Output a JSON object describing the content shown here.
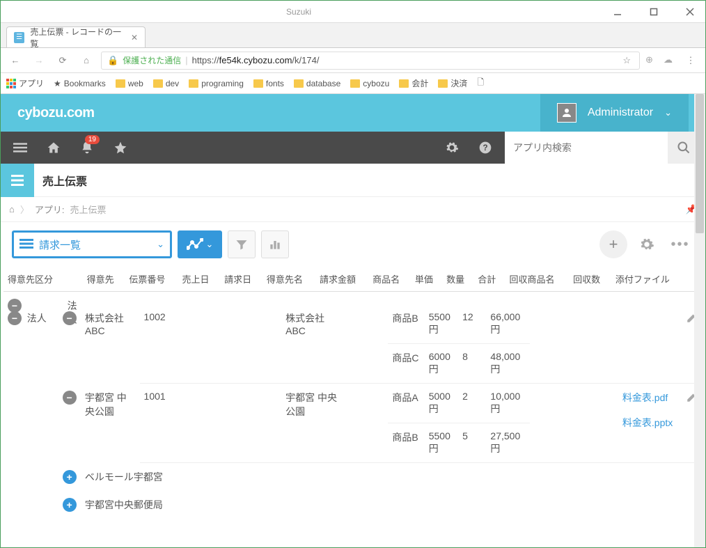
{
  "window": {
    "user": "Suzuki"
  },
  "tab": {
    "title": "売上伝票 - レコードの一覧"
  },
  "url": {
    "secure_label": "保護された通信",
    "prefix": "https://",
    "host": "fe54k.cybozu.com",
    "path": "/k/174/"
  },
  "bookmarks": {
    "apps_label": "アプリ",
    "bookmarks_label": "Bookmarks",
    "folders": [
      "web",
      "dev",
      "programing",
      "fonts",
      "database",
      "cybozu",
      "会計",
      "決済"
    ]
  },
  "header": {
    "logo": "cybozu.com",
    "admin": "Administrator"
  },
  "darkbar": {
    "notification_count": "19",
    "search_placeholder": "アプリ内検索"
  },
  "app": {
    "name": "売上伝票"
  },
  "breadcrumb": {
    "label": "アプリ:",
    "current": "売上伝票"
  },
  "view": {
    "name": "請求一覧"
  },
  "table": {
    "headers": {
      "category": "得意先区分",
      "customer": "得意先",
      "slip_no": "伝票番号",
      "sales_date": "売上日",
      "billing_date": "請求日",
      "customer_name": "得意先名",
      "billing_amount": "請求金額",
      "product": "商品名",
      "unit_price": "単価",
      "qty": "数量",
      "total": "合計",
      "collect_product": "回収商品名",
      "collect_qty": "回収数",
      "attachment": "添付ファイル"
    },
    "category_value": "法人",
    "lines": [
      {
        "product": "商品B",
        "unit_price": "5500円",
        "qty": "12",
        "total": "66,000円"
      },
      {
        "product": "商品C",
        "unit_price": "6000円",
        "qty": "8",
        "total": "48,000円"
      },
      {
        "product": "商品A",
        "unit_price": "5000円",
        "qty": "2",
        "total": "10,000円"
      },
      {
        "product": "商品B",
        "unit_price": "5500円",
        "qty": "5",
        "total": "27,500円"
      }
    ],
    "customers": [
      {
        "name": "株式会社ABC",
        "slip_no": "1002",
        "customer_name": "株式会社ABC"
      },
      {
        "name": "宇都宮 中央公園",
        "slip_no": "1001",
        "customer_name": "宇都宮 中央公園"
      },
      {
        "name": "ベルモール宇都宮"
      },
      {
        "name": "宇都宮中央郵便局"
      }
    ],
    "files": [
      "料金表.pdf",
      "料金表.pptx"
    ]
  }
}
